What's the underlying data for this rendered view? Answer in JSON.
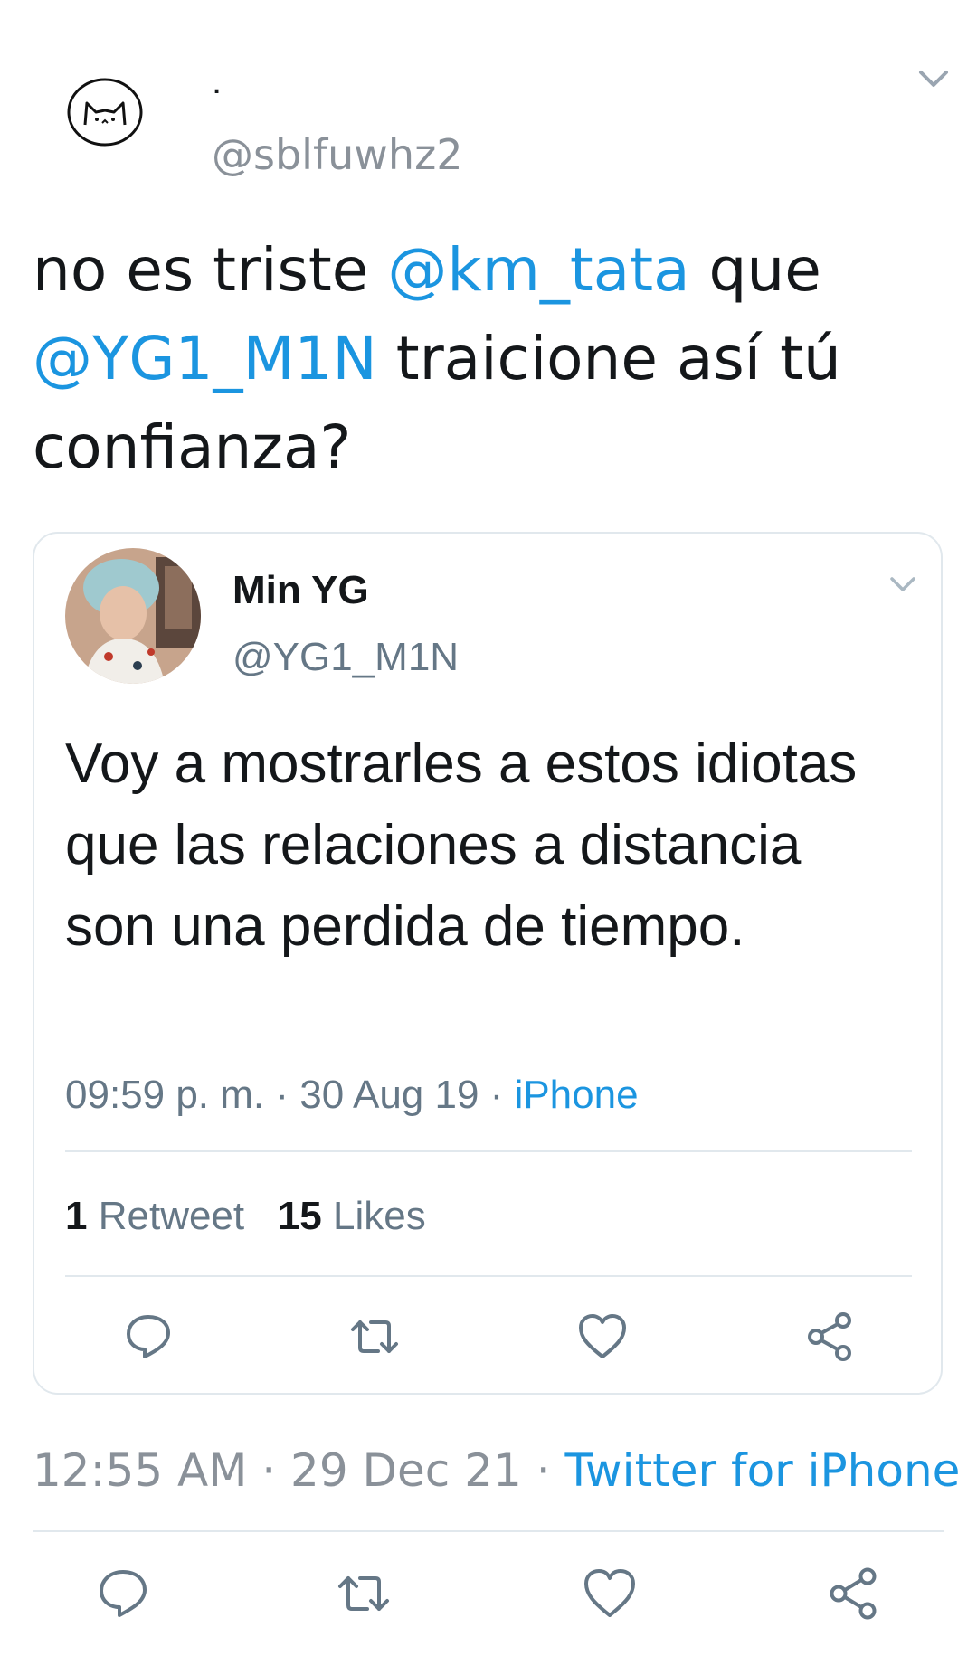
{
  "outer_tweet": {
    "display_name": ".",
    "handle": "@sblfuwhz2",
    "text_parts": [
      {
        "t": "no es triste ",
        "link": false
      },
      {
        "t": "@km_tata",
        "link": true
      },
      {
        "t": " que ",
        "link": false
      },
      {
        "t": "@YG1_M1N",
        "link": true
      },
      {
        "t": " traicione así tú confianza?",
        "link": false
      }
    ],
    "time": "12:55 AM",
    "date": "29 Dec 21",
    "source": "Twitter for iPhone",
    "separator": " · "
  },
  "quoted_tweet": {
    "display_name": "Min YG",
    "handle": "@YG1_M1N",
    "text": "Voy a mostrarles a estos idiotas que las relaciones a distancia son una perdida de tiempo.",
    "time": "09:59 p. m.",
    "date": "30 Aug 19",
    "source": "iPhone",
    "separator": " · ",
    "retweets_count": "1",
    "retweets_label": "Retweet",
    "likes_count": "15",
    "likes_label": "Likes"
  },
  "colors": {
    "link": "#1b95e0",
    "muted": "#8a9199",
    "text": "#14171a",
    "divider": "#e1e8ed"
  }
}
